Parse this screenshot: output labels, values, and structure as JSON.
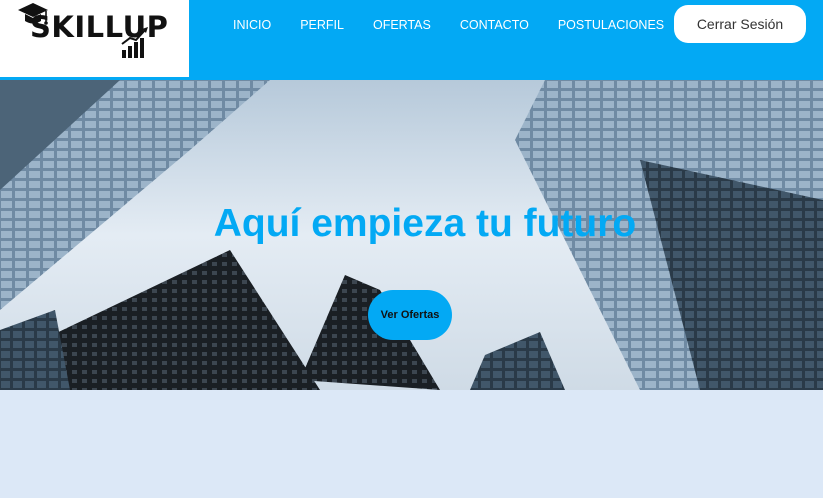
{
  "brand": {
    "name": "SKILLUP"
  },
  "icons": {
    "logo_cap": "graduation-cap-icon",
    "logo_chart": "growth-chart-icon"
  },
  "nav": {
    "links": [
      {
        "label": "INICIO"
      },
      {
        "label": "PERFIL"
      },
      {
        "label": "OFERTAS"
      },
      {
        "label": "CONTACTO"
      },
      {
        "label": "POSTULACIONES"
      }
    ],
    "logout_label": "Cerrar Sesión"
  },
  "hero": {
    "title": "Aquí empieza tu futuro",
    "cta_label": "Ver Ofertas"
  },
  "colors": {
    "accent": "#03a9f4",
    "background": "#dce8f7",
    "header_logo_bg": "#ffffff"
  }
}
